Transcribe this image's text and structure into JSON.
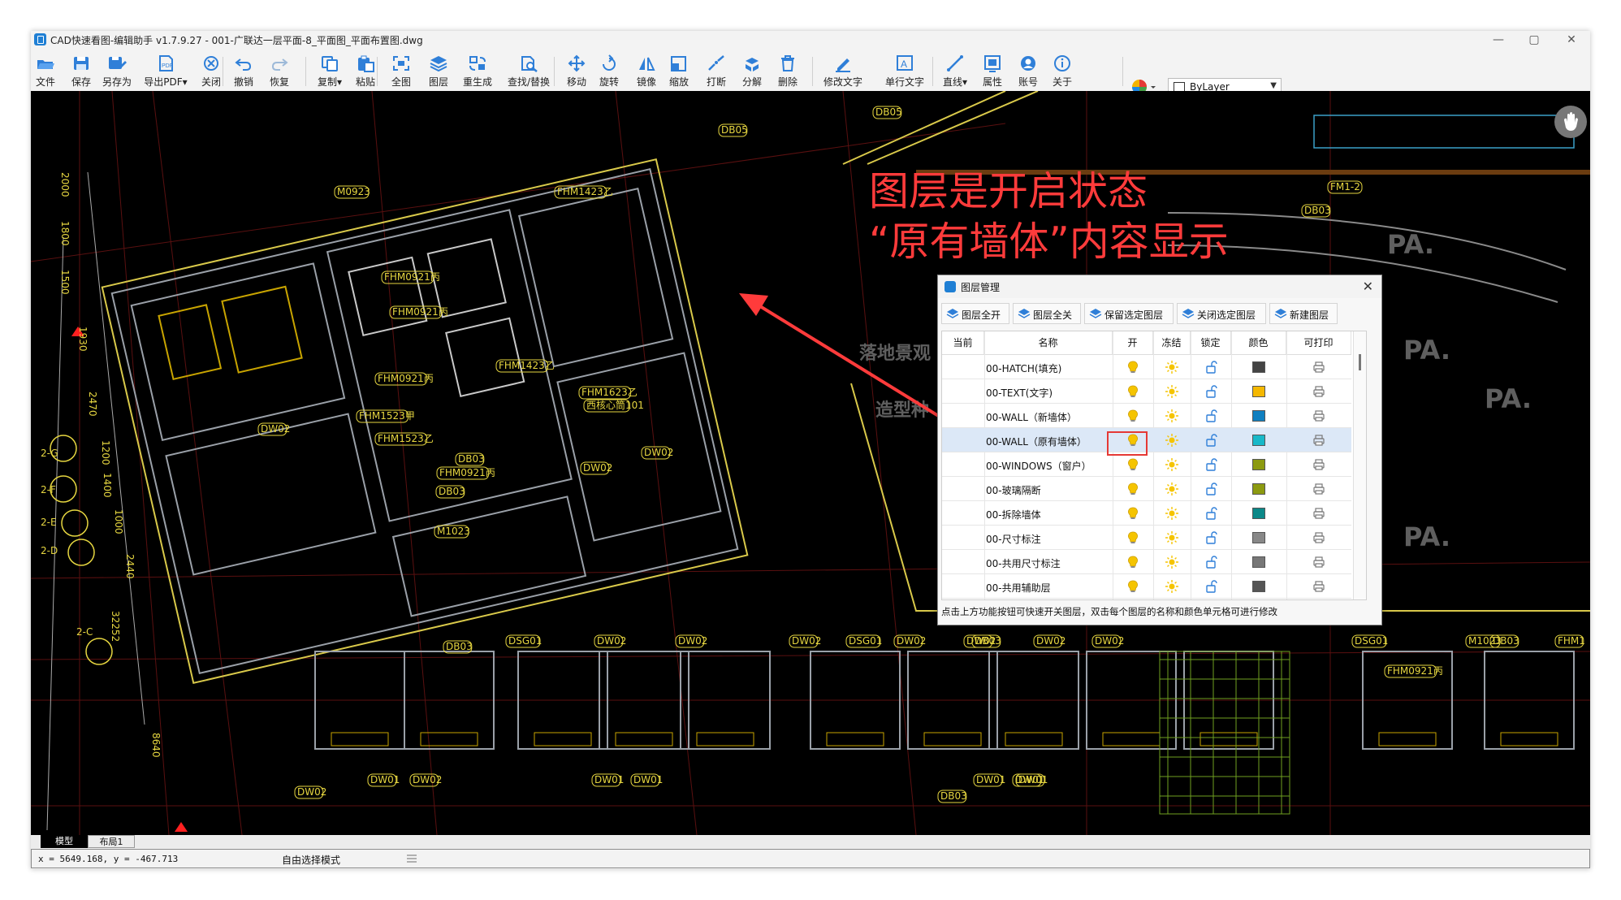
{
  "app": {
    "title": "CAD快速看图-编辑助手 v1.7.9.27 - 001-广联达一层平面-8_平面图_平面布置图.dwg",
    "window_controls": [
      "—",
      "▢",
      "✕"
    ]
  },
  "toolbar": {
    "buttons": [
      {
        "label": "文件",
        "icon": "folder-open-icon"
      },
      {
        "label": "保存",
        "icon": "save-icon"
      },
      {
        "label": "另存为",
        "icon": "save-as-icon"
      },
      {
        "label": "导出PDF▾",
        "icon": "export-pdf-icon"
      },
      {
        "label": "关闭",
        "icon": "close-circle-icon"
      },
      {
        "label": "撤销",
        "icon": "undo-icon"
      },
      {
        "label": "恢复",
        "icon": "redo-icon"
      },
      {
        "label": "复制▾",
        "icon": "copy-icon"
      },
      {
        "label": "粘贴",
        "icon": "paste-icon"
      },
      {
        "label": "全图",
        "icon": "zoom-extents-icon"
      },
      {
        "label": "图层",
        "icon": "layers-icon"
      },
      {
        "label": "重生成",
        "icon": "regen-icon"
      },
      {
        "label": "查找/替换",
        "icon": "find-replace-icon"
      },
      {
        "label": "移动",
        "icon": "move-icon"
      },
      {
        "label": "旋转",
        "icon": "rotate-icon"
      },
      {
        "label": "镜像",
        "icon": "mirror-icon"
      },
      {
        "label": "缩放",
        "icon": "scale-icon"
      },
      {
        "label": "打断",
        "icon": "break-icon"
      },
      {
        "label": "分解",
        "icon": "explode-icon"
      },
      {
        "label": "删除",
        "icon": "delete-icon"
      },
      {
        "label": "修改文字",
        "icon": "edit-text-icon"
      },
      {
        "label": "单行文字",
        "icon": "single-line-text-icon"
      },
      {
        "label": "直线▾",
        "icon": "line-icon"
      },
      {
        "label": "属性",
        "icon": "properties-icon"
      },
      {
        "label": "账号",
        "icon": "account-icon"
      },
      {
        "label": "关于",
        "icon": "info-icon"
      }
    ],
    "linetype_value": "ByLayer"
  },
  "annotation": {
    "line1": "图层是开启状态",
    "line2": "“原有墙体”内容显示",
    "color": "#ff3b3b"
  },
  "drawing": {
    "labels": [
      "DB05",
      "DB05",
      "M0923",
      "FHM1423乙",
      "FHM0921丙",
      "FHM0921丙",
      "FHM0921丙",
      "FHM1423乙",
      "FHM1623乙",
      "西核心筒101",
      "FHM1523甲",
      "FHM1523乙",
      "FHM0921丙",
      "M1023",
      "DW02",
      "DB03",
      "DB03",
      "DW02",
      "DW02",
      "DB03",
      "DSG01",
      "DW02",
      "DW02",
      "DW02",
      "DSG01",
      "DW02",
      "DB03",
      "DW02",
      "DW02",
      "DW02",
      "DSG01",
      "M1023",
      "DB03",
      "FHM1",
      "FHM0921丙",
      "DW01",
      "DW02",
      "DW01",
      "DW01",
      "DW01",
      "DW01",
      "DW01",
      "DW02",
      "DB03",
      "FM1-2",
      "DB03",
      "PA.",
      "PA.",
      "PA.",
      "PA.",
      "2000",
      "1800",
      "1500",
      "1930",
      "2470",
      "1200",
      "1400",
      "1000",
      "2440",
      "32252",
      "8640",
      "2-G",
      "2-F",
      "2-E",
      "2-D",
      "2-C",
      "落地景观",
      "造型种"
    ]
  },
  "tabs": [
    "模型",
    "布局1"
  ],
  "status": {
    "coords": "x = 5649.168,  y = -467.713",
    "mode": "自由选择模式"
  },
  "layer_dialog": {
    "title": "图层管理",
    "buttons": [
      "图层全开",
      "图层全关",
      "保留选定图层",
      "关闭选定图层",
      "新建图层"
    ],
    "columns": [
      "当前",
      "名称",
      "开",
      "冻结",
      "锁定",
      "颜色",
      "可打印"
    ],
    "rows": [
      {
        "name": "00-HATCH(填充)",
        "color": "#444444"
      },
      {
        "name": "00-TEXT(文字)",
        "color": "#f5b800"
      },
      {
        "name": "00-WALL（新墙体）",
        "color": "#0f7fc0"
      },
      {
        "name": "00-WALL（原有墙体）",
        "color": "#18b8c8",
        "selected": true
      },
      {
        "name": "00-WINDOWS（窗户）",
        "color": "#8c9a10"
      },
      {
        "name": "00-玻璃隔断",
        "color": "#8c9a10"
      },
      {
        "name": "00-拆除墙体",
        "color": "#0b8888"
      },
      {
        "name": "00-尺寸标注",
        "color": "#888888"
      },
      {
        "name": "00-共用尺寸标注",
        "color": "#777777"
      },
      {
        "name": "00-共用辅助层",
        "color": "#555555"
      }
    ],
    "footer": "点击上方功能按钮可快速开关图层，双击每个图层的名称和颜色单元格可进行修改"
  }
}
